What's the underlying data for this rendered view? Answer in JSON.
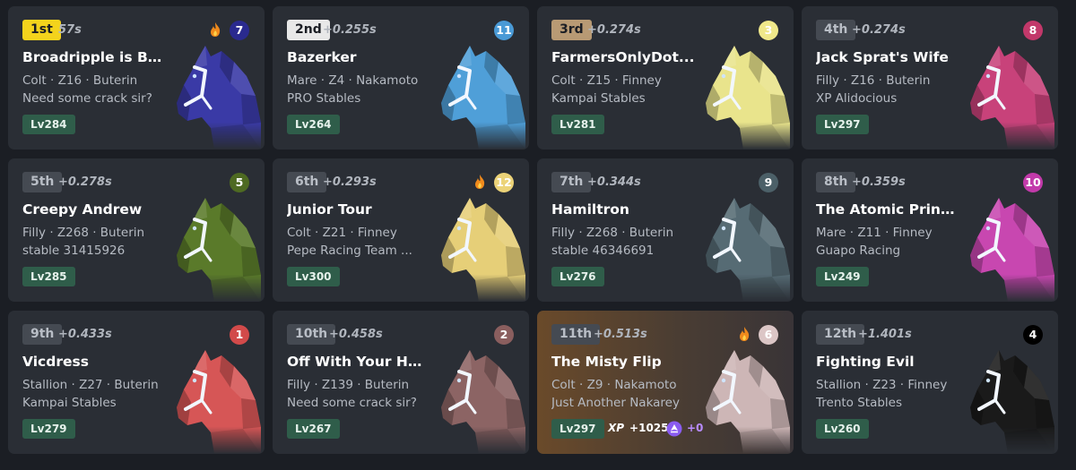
{
  "cards": [
    {
      "position": "1st",
      "time": "57s",
      "name": "Broadripple is Bu...",
      "line1": "Colt · Z16 · Buterin",
      "line2": "Need some crack sir?",
      "level": "Lv284",
      "gate": "7",
      "gate_bg": "#2a2a8f",
      "gate_fg": "#ffffff",
      "coat": "#3a3aa6",
      "flame": true
    },
    {
      "position": "2nd",
      "time": "+0.255s",
      "name": "Bazerker",
      "line1": "Mare · Z4 · Nakamoto",
      "line2": "PRO Stables",
      "level": "Lv264",
      "gate": "11",
      "gate_bg": "#4a9ad6",
      "gate_fg": "#ffffff",
      "coat": "#4f9fd8",
      "flame": false
    },
    {
      "position": "3rd",
      "time": "+0.274s",
      "name": "FarmersOnlyDot...",
      "line1": "Colt · Z15 · Finney",
      "line2": "Kampai Stables",
      "level": "Lv281",
      "gate": "3",
      "gate_bg": "#efe88a",
      "gate_fg": "#ffffff",
      "coat": "#e9e48c",
      "flame": false
    },
    {
      "position": "4th",
      "time": "+0.274s",
      "name": "Jack Sprat's Wife",
      "line1": "Filly · Z16 · Buterin",
      "line2": "XP Alidocious",
      "level": "Lv297",
      "gate": "8",
      "gate_bg": "#c2386a",
      "gate_fg": "#ffffff",
      "coat": "#c8427a",
      "flame": false
    },
    {
      "position": "5th",
      "time": "+0.278s",
      "name": "Creepy Andrew",
      "line1": "Filly · Z268 · Buterin",
      "line2": "stable 31415926",
      "level": "Lv285",
      "gate": "5",
      "gate_bg": "#4e6a22",
      "gate_fg": "#ffffff",
      "coat": "#5a7a2a",
      "flame": false
    },
    {
      "position": "6th",
      "time": "+0.293s",
      "name": "Junior Tour",
      "line1": "Colt · Z21 · Finney",
      "line2": "Pepe Racing Team ...",
      "level": "Lv300",
      "gate": "12",
      "gate_bg": "#ecd378",
      "gate_fg": "#ffffff",
      "coat": "#e6cf78",
      "flame": true
    },
    {
      "position": "7th",
      "time": "+0.344s",
      "name": "Hamiltron",
      "line1": "Filly · Z268 · Buterin",
      "line2": "stable 46346691",
      "level": "Lv276",
      "gate": "9",
      "gate_bg": "#4c6068",
      "gate_fg": "#ffffff",
      "coat": "#566b74",
      "flame": false
    },
    {
      "position": "8th",
      "time": "+0.359s",
      "name": "The Atomic Princ...",
      "line1": "Mare · Z11 · Finney",
      "line2": "Guapo Racing",
      "level": "Lv249",
      "gate": "10",
      "gate_bg": "#c23aaa",
      "gate_fg": "#ffffff",
      "coat": "#c847b0",
      "flame": false
    },
    {
      "position": "9th",
      "time": "+0.433s",
      "name": "Vicdress",
      "line1": "Stallion · Z27 · Buterin",
      "line2": "Kampai Stables",
      "level": "Lv279",
      "gate": "1",
      "gate_bg": "#d24a4a",
      "gate_fg": "#ffffff",
      "coat": "#d65656",
      "flame": false
    },
    {
      "position": "10th",
      "time": "+0.458s",
      "name": "Off With Your He...",
      "line1": "Filly · Z139 · Buterin",
      "line2": "Need some crack sir?",
      "level": "Lv267",
      "gate": "2",
      "gate_bg": "#8a5e5e",
      "gate_fg": "#ffffff",
      "coat": "#8c6464",
      "flame": false
    },
    {
      "position": "11th",
      "time": "+0.513s",
      "name": "The Misty Flip",
      "line1": "Colt · Z9 · Nakamoto",
      "line2": "Just Another Nakarey",
      "level": "Lv297",
      "gate": "6",
      "gate_bg": "#dcc6c6",
      "gate_fg": "#ffffff",
      "coat": "#cdb6b6",
      "flame": true,
      "highlight": true,
      "xp_label": "XP",
      "xp_value": "+1025",
      "zed_value": "+0"
    },
    {
      "position": "12th",
      "time": "+1.401s",
      "name": "Fighting Evil",
      "line1": "Stallion · Z23 · Finney",
      "line2": "Trento Stables",
      "level": "Lv260",
      "gate": "4",
      "gate_bg": "#000000",
      "gate_fg": "#ffffff",
      "coat": "#1a1a1a",
      "flame": false
    }
  ]
}
